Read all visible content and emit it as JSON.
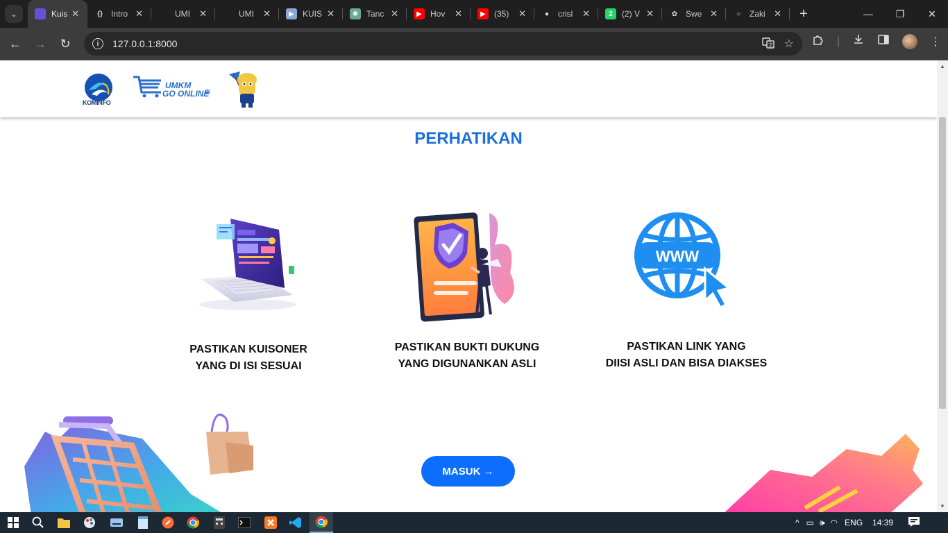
{
  "browser": {
    "tabs": [
      {
        "label": "Kuis",
        "icon": "laravel-icon",
        "color": "#6b4fd8",
        "glyph": "",
        "active": true
      },
      {
        "label": "Intro",
        "icon": "code-brackets-icon",
        "color": "#1f1f1f",
        "glyph": "{}",
        "active": false
      },
      {
        "label": "UMI",
        "icon": "figma-icon",
        "color": "#1f1f1f",
        "glyph": "",
        "active": false
      },
      {
        "label": "UMI",
        "icon": "figma-icon",
        "color": "#1f1f1f",
        "glyph": "",
        "active": false
      },
      {
        "label": "KUIS",
        "icon": "play-icon",
        "color": "#8aa7d9",
        "glyph": "▶",
        "active": false
      },
      {
        "label": "Tanc",
        "icon": "chatgpt-icon",
        "color": "#6ca89a",
        "glyph": "✺",
        "active": false
      },
      {
        "label": "Hov",
        "icon": "youtube-icon",
        "color": "#ff0000",
        "glyph": "▶",
        "active": false
      },
      {
        "label": "(35)",
        "icon": "youtube-icon",
        "color": "#ff0000",
        "glyph": "▶",
        "active": false
      },
      {
        "label": "crisl",
        "icon": "github-icon",
        "color": "#1f1f1f",
        "glyph": "●",
        "active": false
      },
      {
        "label": "(2) V",
        "icon": "whatsapp-icon",
        "color": "#25d366",
        "glyph": "2",
        "active": false
      },
      {
        "label": "Swe",
        "icon": "sweetalert-icon",
        "color": "#1f1f1f",
        "glyph": "✿",
        "active": false
      },
      {
        "label": "Zaki",
        "icon": "github-icon",
        "color": "#1f1f1f",
        "glyph": "○",
        "active": false
      }
    ],
    "url": "127.0.0.1:8000"
  },
  "header": {
    "logo_kominfo_text": "KOMINFO",
    "logo_umkm_line1": "UMKM",
    "logo_umkm_line2": "GO ONLINE",
    "logo_umkm_badge": "id"
  },
  "main": {
    "title": "PERHATIKAN",
    "cards": [
      {
        "line1": "PASTIKAN KUISONER",
        "line2": "YANG DI ISI SESUAI",
        "illustration": "laptop-dashboard-illustration"
      },
      {
        "line1": "PASTIKAN BUKTI DUKUNG",
        "line2": "YANG DIGUNANKAN ASLI",
        "illustration": "phone-shield-illustration"
      },
      {
        "line1": "PASTIKAN LINK YANG",
        "line2": "DIISI ASLI DAN BISA DIAKSES",
        "illustration": "www-globe-icon"
      }
    ],
    "globe_text": "WWW",
    "button_label": "MASUK →"
  },
  "colors": {
    "accent": "#1a6fe0",
    "button": "#0d6efd",
    "globe": "#1e8ef0"
  },
  "taskbar": {
    "language": "ENG",
    "time": "14:39"
  }
}
